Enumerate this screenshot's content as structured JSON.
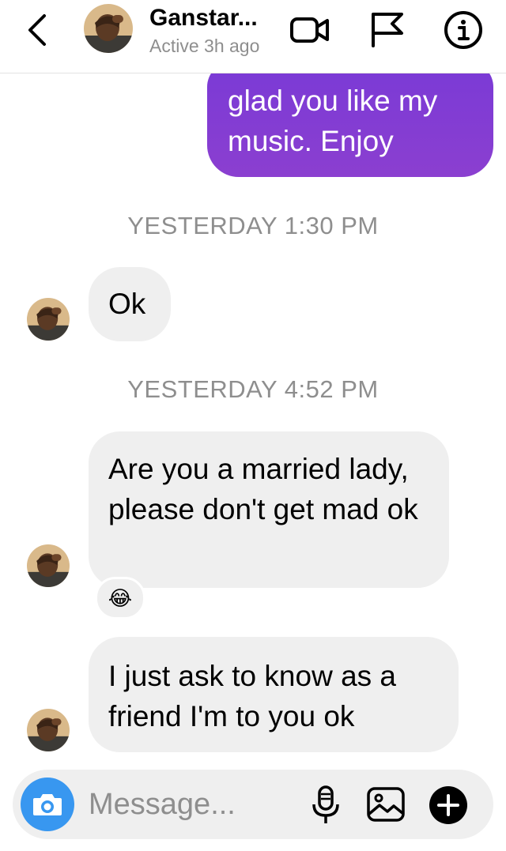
{
  "header": {
    "contact_name": "Ganstar...",
    "status": "Active 3h ago",
    "icons": [
      "back-chevron-icon",
      "avatar",
      "video-call-icon",
      "flag-icon",
      "info-icon"
    ]
  },
  "messages": [
    {
      "side": "outgoing",
      "text": "glad you like my music. Enjoy"
    },
    {
      "type": "timestamp",
      "text": "YESTERDAY 1:30 PM"
    },
    {
      "side": "incoming",
      "text": "Ok"
    },
    {
      "type": "timestamp",
      "text": "YESTERDAY 4:52 PM"
    },
    {
      "side": "incoming",
      "text": "Are you a married lady, please don't get mad ok",
      "reaction": "😂"
    },
    {
      "side": "incoming",
      "text": "I just ask to know as a friend I'm to you ok"
    }
  ],
  "composer": {
    "placeholder": "Message...",
    "icons": [
      "camera-icon",
      "microphone-icon",
      "gallery-icon",
      "plus-icon"
    ]
  },
  "colors": {
    "outgoing_bubble": "#8340d4",
    "incoming_bubble": "#efefef",
    "camera_button": "#3897f0",
    "muted_text": "#8e8e8e"
  }
}
